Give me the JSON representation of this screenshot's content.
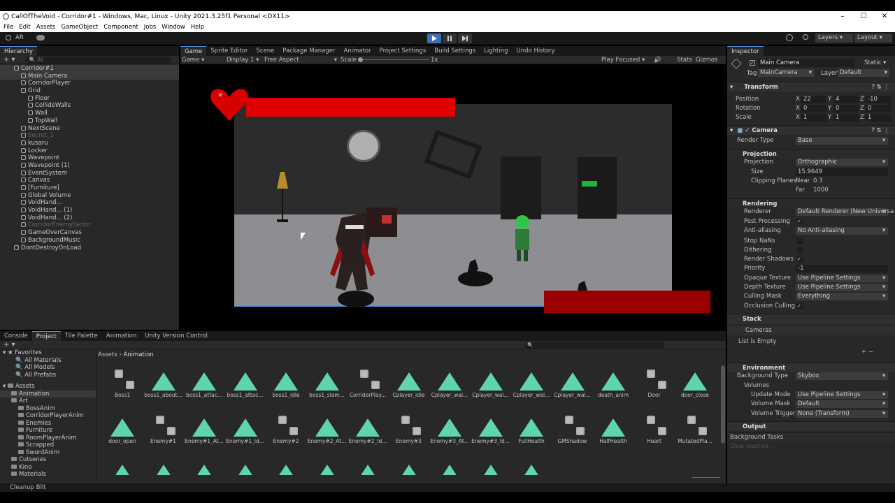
{
  "window": {
    "title": "CallOfTheVoid - Corridor#1 - Windows, Mac, Linux - Unity 2021.3.25f1 Personal <DX11>",
    "min": "–",
    "max": "☐",
    "close": "✕"
  },
  "menu": [
    "File",
    "Edit",
    "Assets",
    "GameObject",
    "Component",
    "Jobs",
    "Window",
    "Help"
  ],
  "toolbar": {
    "account": "AR",
    "layers": "Layers",
    "layout": "Layout"
  },
  "hierarchy": {
    "tab": "Hierarchy",
    "search_placeholder": "All",
    "rows": [
      {
        "label": "Corridor#1",
        "indent": 0,
        "sel": true,
        "dim": false
      },
      {
        "label": "Main Camera",
        "indent": 1,
        "sel": true,
        "dim": false
      },
      {
        "label": "CorridorPlayer",
        "indent": 1,
        "sel": false,
        "dim": false
      },
      {
        "label": "Grid",
        "indent": 1,
        "sel": false,
        "dim": false
      },
      {
        "label": "Floor",
        "indent": 2,
        "sel": false,
        "dim": false
      },
      {
        "label": "CollideWalls",
        "indent": 2,
        "sel": false,
        "dim": false
      },
      {
        "label": "Wall",
        "indent": 2,
        "sel": false,
        "dim": false
      },
      {
        "label": "TopWall",
        "indent": 2,
        "sel": false,
        "dim": false
      },
      {
        "label": "NextScene",
        "indent": 1,
        "sel": false,
        "dim": false
      },
      {
        "label": "Secret_1",
        "indent": 1,
        "sel": false,
        "dim": true
      },
      {
        "label": "kusaru",
        "indent": 1,
        "sel": false,
        "dim": false
      },
      {
        "label": "Locker",
        "indent": 1,
        "sel": false,
        "dim": false
      },
      {
        "label": "Wavepoint",
        "indent": 1,
        "sel": false,
        "dim": false
      },
      {
        "label": "Wavepoint (1)",
        "indent": 1,
        "sel": false,
        "dim": false
      },
      {
        "label": "EventSystem",
        "indent": 1,
        "sel": false,
        "dim": false
      },
      {
        "label": "Canvas",
        "indent": 1,
        "sel": false,
        "dim": false
      },
      {
        "label": "[Furniture]",
        "indent": 1,
        "sel": false,
        "dim": false
      },
      {
        "label": "Global Volume",
        "indent": 1,
        "sel": false,
        "dim": false
      },
      {
        "label": "VoidHand...",
        "indent": 1,
        "sel": false,
        "dim": false
      },
      {
        "label": "VoidHand... (1)",
        "indent": 1,
        "sel": false,
        "dim": false
      },
      {
        "label": "VoidHand... (2)",
        "indent": 1,
        "sel": false,
        "dim": false
      },
      {
        "label": "CorridorEnemyFactor",
        "indent": 1,
        "sel": false,
        "dim": true
      },
      {
        "label": "GameOverCanvas",
        "indent": 1,
        "sel": false,
        "dim": false
      },
      {
        "label": "BackgroundMusic",
        "indent": 1,
        "sel": false,
        "dim": false
      },
      {
        "label": "DontDestroyOnLoad",
        "indent": 0,
        "sel": false,
        "dim": false
      }
    ]
  },
  "center_tabs": [
    "Game",
    "Sprite Editor",
    "Scene",
    "Package Manager",
    "Animator",
    "Project Settings",
    "Build Settings",
    "Lighting",
    "Undo History"
  ],
  "game_bar": {
    "mode": "Game",
    "display": "Display 1",
    "aspect": "Free Aspect",
    "scale_label": "Scale",
    "scale_value": "1x",
    "play_focus": "Play Focused",
    "stats": "Stats",
    "gizmos": "Gizmos"
  },
  "inspector": {
    "tab": "Inspector",
    "object_name": "Main Camera",
    "static": "Static",
    "tag_label": "Tag",
    "tag": "MainCamera",
    "layer_label": "Layer",
    "layer": "Default",
    "transform": {
      "title": "Transform",
      "position_label": "Position",
      "rotation_label": "Rotation",
      "scale_label": "Scale",
      "position": [
        "22",
        "4",
        "-10"
      ],
      "rotation": [
        "0",
        "0",
        "0"
      ],
      "scale": [
        "1",
        "1",
        "1"
      ]
    },
    "camera": {
      "title": "Camera",
      "render_type_label": "Render Type",
      "render_type": "Base",
      "projection_section": "Projection",
      "projection_label": "Projection",
      "projection": "Orthographic",
      "size_label": "Size",
      "size": "15.9649",
      "clipping_label": "Clipping Planes",
      "near_label": "Near",
      "near": "0.3",
      "far_label": "Far",
      "far": "1000",
      "rendering_section": "Rendering",
      "renderer_label": "Renderer",
      "renderer": "Default Renderer (New Universa",
      "post_label": "Post Processing",
      "aa_label": "Anti-aliasing",
      "aa": "No Anti-aliasing",
      "stopnan_label": "Stop NaNs",
      "dither_label": "Dithering",
      "shadows_label": "Render Shadows",
      "priority_label": "Priority",
      "priority": "-1",
      "opaque_label": "Opaque Texture",
      "opaque": "Use Pipeline Settings",
      "depth_label": "Depth Texture",
      "depth": "Use Pipeline Settings",
      "culling_label": "Culling Mask",
      "culling": "Everything",
      "occlusion_label": "Occlusion Culling",
      "stack_section": "Stack",
      "cameras_label": "Cameras",
      "list_empty": "List is Empty",
      "env_section": "Environment",
      "bg_label": "Background Type",
      "bg": "Skybox",
      "volumes_label": "Volumes",
      "update_label": "Update Mode",
      "update": "Use Pipeline Settings",
      "mask_label": "Volume Mask",
      "mask": "Default",
      "trigger_label": "Volume Trigger",
      "trigger": "None (Transform)",
      "output_section": "Output"
    },
    "bg_tasks": "Background Tasks",
    "clear_inactive": "Clear inactive"
  },
  "bottom_tabs": [
    "Console",
    "Project",
    "Tile Palette",
    "Animation",
    "Unity Version Control"
  ],
  "project": {
    "favorites_label": "Favorites",
    "favorites": [
      "All Materials",
      "All Models",
      "All Prefabs"
    ],
    "assets_label": "Assets",
    "folders": [
      {
        "label": "Animation",
        "indent": 1
      },
      {
        "label": "Art",
        "indent": 1
      },
      {
        "label": "BossAnim",
        "indent": 2
      },
      {
        "label": "CorridorPlayerAnim",
        "indent": 2
      },
      {
        "label": "Enemies",
        "indent": 2
      },
      {
        "label": "Furniture",
        "indent": 2
      },
      {
        "label": "RoomPlayerAnim",
        "indent": 2
      },
      {
        "label": "Scrapped",
        "indent": 2
      },
      {
        "label": "SwordAnim",
        "indent": 2
      },
      {
        "label": "Cutsenes",
        "indent": 1
      },
      {
        "label": "Kino",
        "indent": 1
      },
      {
        "label": "Materials",
        "indent": 1
      }
    ],
    "breadcrumb_root": "Assets",
    "breadcrumb_leaf": "Animation",
    "assets": [
      {
        "name": "Boss1",
        "kind": "ctrl"
      },
      {
        "name": "boss1_about...",
        "kind": "anim"
      },
      {
        "name": "boss1_attac...",
        "kind": "anim"
      },
      {
        "name": "boss1_attac...",
        "kind": "anim"
      },
      {
        "name": "boss1_idle",
        "kind": "anim"
      },
      {
        "name": "boss1_slam...",
        "kind": "anim"
      },
      {
        "name": "CorridorPlay...",
        "kind": "ctrl"
      },
      {
        "name": "Cplayer_idle",
        "kind": "anim"
      },
      {
        "name": "Cplayer_wal...",
        "kind": "anim"
      },
      {
        "name": "Cplayer_wal...",
        "kind": "anim"
      },
      {
        "name": "Cplayer_wal...",
        "kind": "anim"
      },
      {
        "name": "Cplayer_wal...",
        "kind": "anim"
      },
      {
        "name": "death_anim",
        "kind": "anim"
      },
      {
        "name": "Door",
        "kind": "ctrl"
      },
      {
        "name": "door_close",
        "kind": "anim"
      },
      {
        "name": "door_open",
        "kind": "anim"
      },
      {
        "name": "Enemy#1",
        "kind": "ctrl"
      },
      {
        "name": "Enemy#1_At...",
        "kind": "anim"
      },
      {
        "name": "Enemy#1_Id...",
        "kind": "anim"
      },
      {
        "name": "Enemy#2",
        "kind": "ctrl"
      },
      {
        "name": "Enemy#2_At...",
        "kind": "anim"
      },
      {
        "name": "Enemy#2_Id...",
        "kind": "anim"
      },
      {
        "name": "Enemy#3",
        "kind": "ctrl"
      },
      {
        "name": "Enemy#3_At...",
        "kind": "anim"
      },
      {
        "name": "Enemy#3_Id...",
        "kind": "anim"
      },
      {
        "name": "FullHealth",
        "kind": "anim"
      },
      {
        "name": "GMShadow",
        "kind": "ctrl"
      },
      {
        "name": "HalfHealth",
        "kind": "anim"
      },
      {
        "name": "Heart",
        "kind": "ctrl"
      },
      {
        "name": "MutatedPla...",
        "kind": "ctrl"
      }
    ]
  },
  "status": "Cleanup Blit",
  "colors": {
    "anim_icon": "#5fd4b0",
    "health_bar": "#e00000",
    "selection_accent": "#4a90e2"
  }
}
